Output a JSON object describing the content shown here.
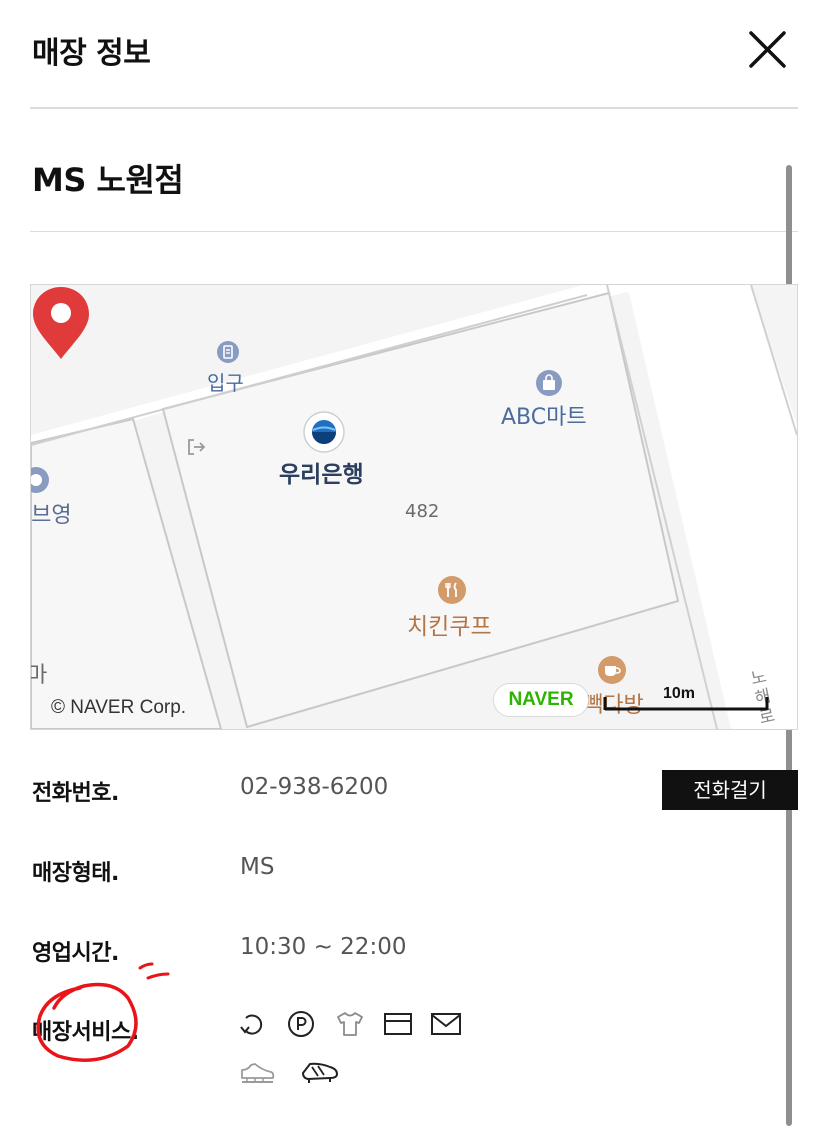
{
  "header": {
    "title": "매장 정보"
  },
  "store": {
    "name": "MS 노원점"
  },
  "map": {
    "labels": {
      "entrance": "입구",
      "abc_mart": "ABC마트",
      "woori_bank": "우리은행",
      "address_no": "482",
      "chicken": "치킨쿠프",
      "left_edge": "l브영",
      "left_bottom": "마",
      "cafe": "빽다방",
      "road": "노해로"
    },
    "copyright": "© NAVER Corp.",
    "badge": "NAVER",
    "scale": "10m"
  },
  "info": {
    "phone_label": "전화번호.",
    "phone_value": "02-938-6200",
    "call_button": "전화걸기",
    "type_label": "매장형태.",
    "type_value": "MS",
    "hours_label": "영업시간.",
    "hours_value": "10:30 ~ 22:00",
    "service_label": "매장서비스."
  },
  "services": {
    "icons": [
      "exchange-icon",
      "parking-icon",
      "tshirt-icon",
      "card-icon",
      "mail-icon",
      "running-shoe-icon",
      "soccer-cleat-icon"
    ]
  },
  "colors": {
    "pin": "#e03a3a",
    "naver_green": "#2db400",
    "poi_blue": "#4a6b9e",
    "poi_orange": "#c98a5a",
    "annotation_red": "#e8141a"
  }
}
